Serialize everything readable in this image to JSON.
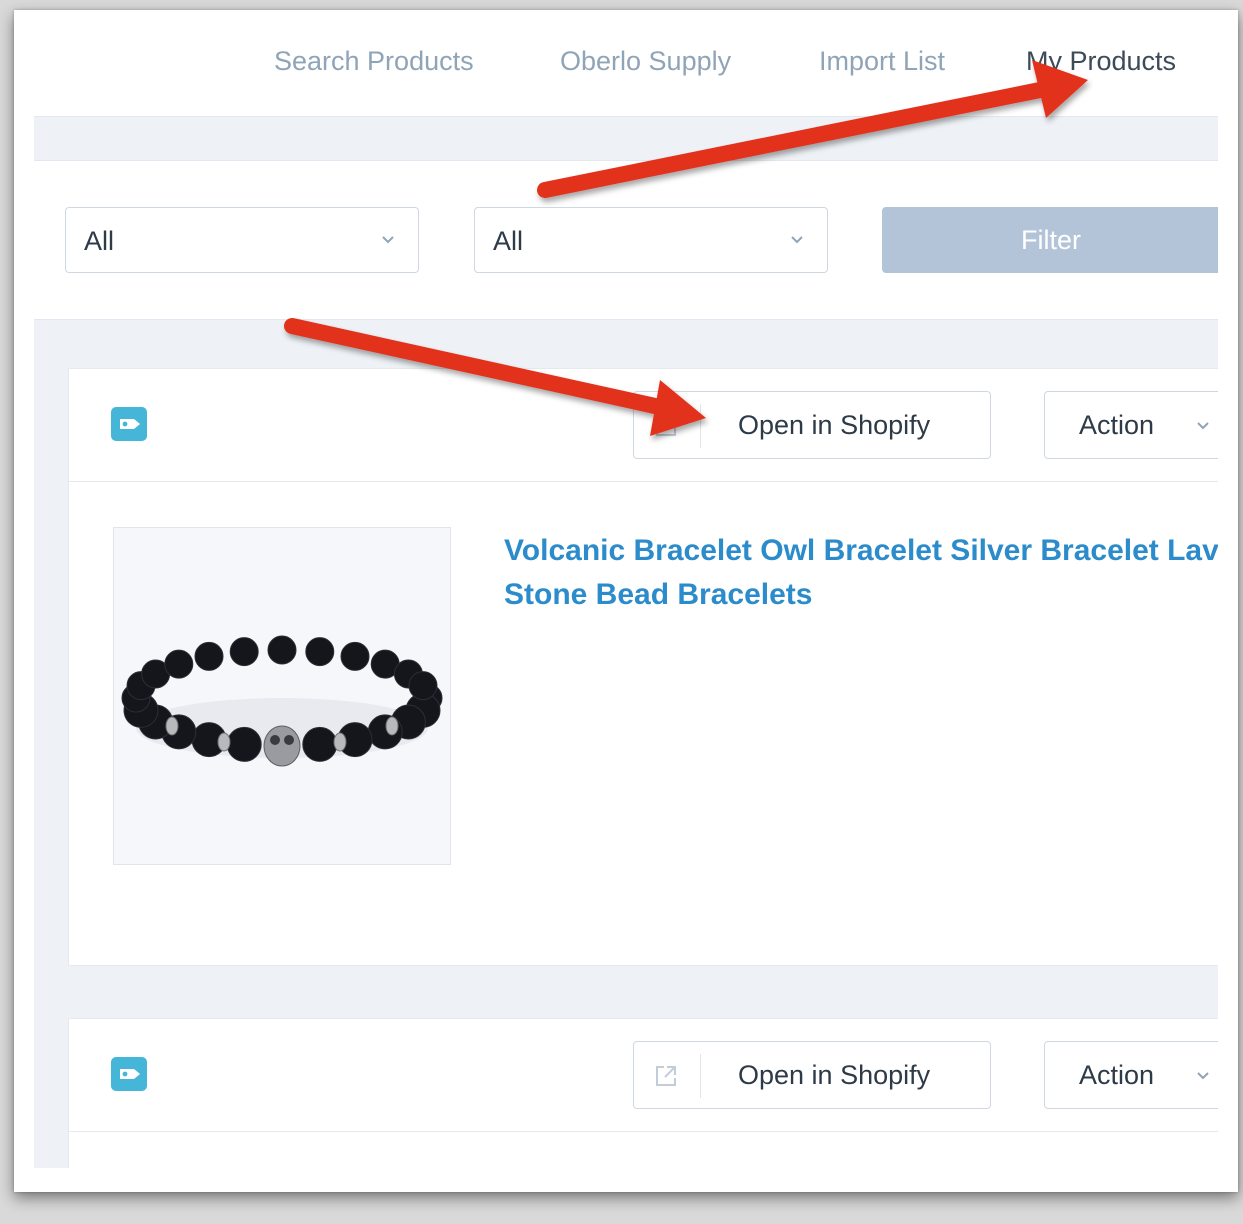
{
  "nav": {
    "tabs": [
      {
        "label": "Search Products"
      },
      {
        "label": "Oberlo Supply"
      },
      {
        "label": "Import List"
      },
      {
        "label": "My Products"
      }
    ],
    "active_tab": "My Products"
  },
  "filters": {
    "select_1": {
      "value": "All"
    },
    "select_2": {
      "value": "All"
    },
    "filter_button": "Filter"
  },
  "products": [
    {
      "open_label": "Open in Shopify",
      "action_label": "Action",
      "title": "Volcanic Bracelet Owl Bracelet Silver Bracelet Lava Stone Bead Bracelets"
    },
    {
      "open_label": "Open in Shopify",
      "action_label": "Action"
    }
  ],
  "colors": {
    "accent_link": "#2c8ccb",
    "tag_icon": "#45b6d8",
    "filter_button": "#b4c4d8",
    "annotation_arrow": "#e2311d"
  },
  "icons": [
    "tag-icon",
    "external-link-icon",
    "chevron-down-icon",
    "arrow-annotation"
  ]
}
